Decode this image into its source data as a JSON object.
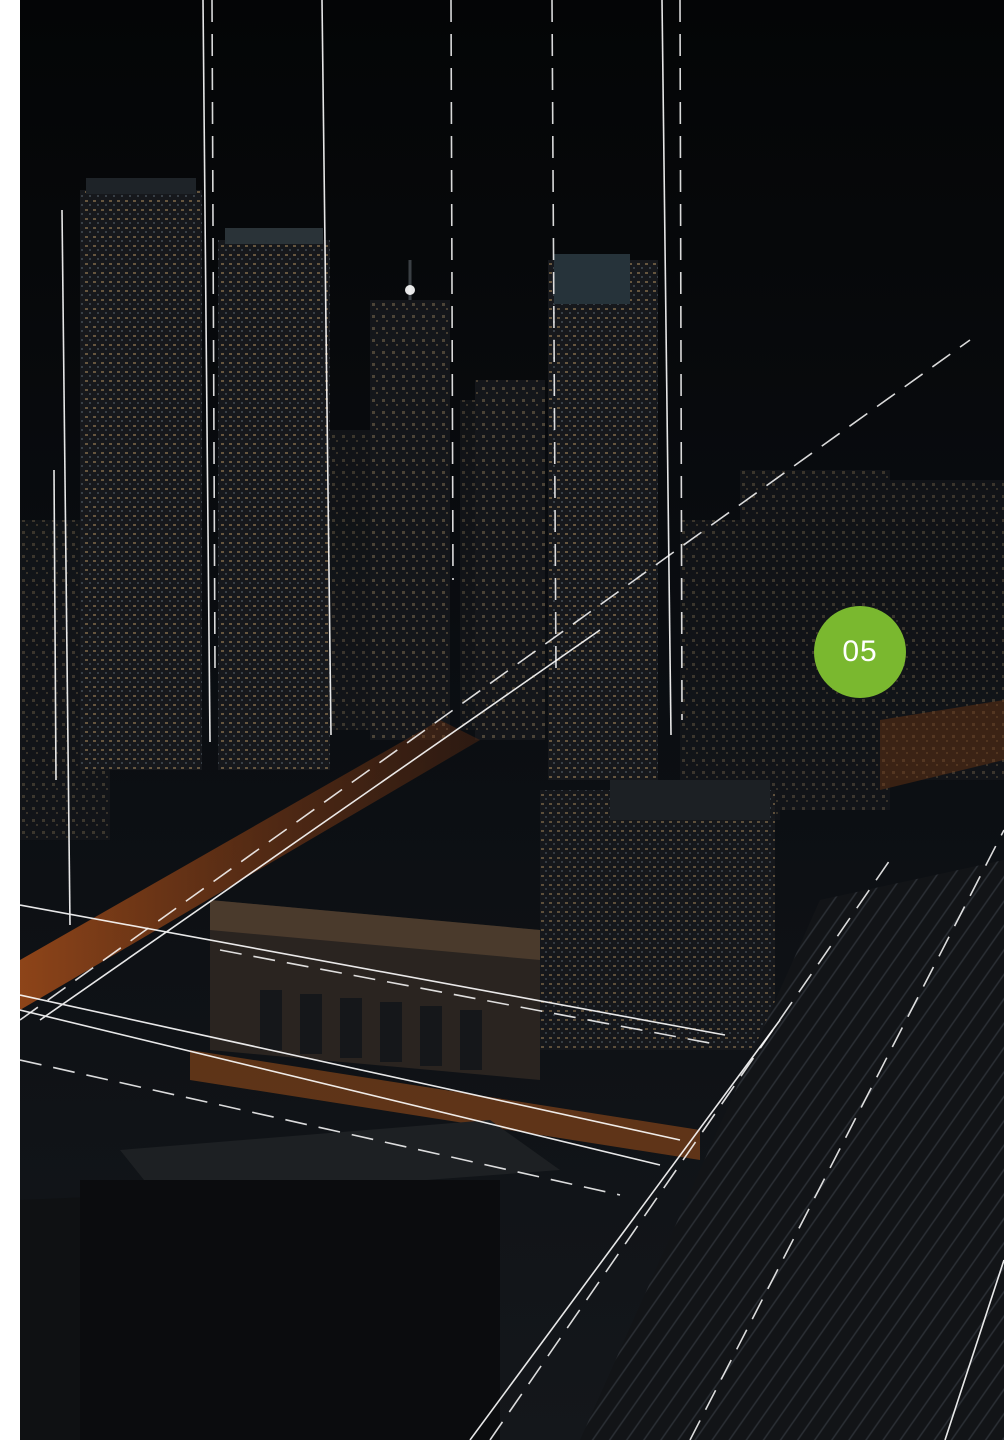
{
  "page": {
    "badge_number": "05",
    "accent_color": "#7ab82f",
    "background_color": "#07090c"
  }
}
